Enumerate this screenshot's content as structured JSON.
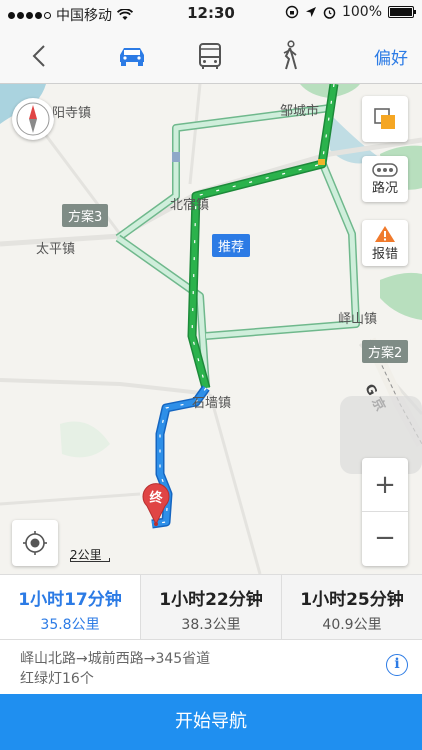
{
  "status_bar": {
    "carrier": "中国移动",
    "time": "12:30",
    "battery": "100%",
    "battery_level": 1.0
  },
  "nav": {
    "modes": [
      "car-icon",
      "bus-icon",
      "walk-icon"
    ],
    "selected_mode": "car-icon",
    "preference_label": "偏好"
  },
  "map": {
    "places": {
      "top_left": "阳寺镇",
      "top_right": "邹城市",
      "beisu": "北宿镇",
      "taiping": "太平镇",
      "yishan": "峄山镇",
      "shiqiang": "石墙镇"
    },
    "route_tags": {
      "plan3": "方案3",
      "recommended": "推荐",
      "plan2": "方案2"
    },
    "road_label": "G 京",
    "end_marker": "终",
    "scale": "2公里",
    "controls": {
      "traffic": "路况",
      "report": "报错",
      "zoom_in": "+",
      "zoom_out": "−"
    }
  },
  "routes": [
    {
      "time": "1小时17分钟",
      "distance": "35.8公里",
      "selected": true
    },
    {
      "time": "1小时22分钟",
      "distance": "38.3公里",
      "selected": false
    },
    {
      "time": "1小时25分钟",
      "distance": "40.9公里",
      "selected": false
    }
  ],
  "detail": {
    "roads": "峄山北路→城前西路→345省道",
    "lights": "红绿灯16个"
  },
  "start_button": "开始导航",
  "colors": {
    "accent": "#2c7be5",
    "route_green": "#2bb24c",
    "route_alt": "#b8e0c8",
    "end_red": "#e04545"
  }
}
